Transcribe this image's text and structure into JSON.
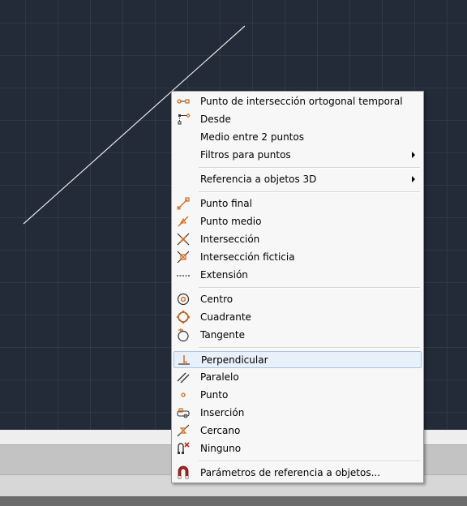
{
  "menu": {
    "items": [
      {
        "label": "Punto de intersección ortogonal temporal",
        "icon": "temporary-track-icon"
      },
      {
        "label": "Desde",
        "icon": "from-icon"
      },
      {
        "label": "Medio entre 2 puntos",
        "icon": ""
      },
      {
        "label": "Filtros para puntos",
        "icon": "",
        "submenu": true
      },
      {
        "label": "Referencia a objetos 3D",
        "icon": "",
        "submenu": true
      },
      {
        "label": "Punto final",
        "icon": "endpoint-icon"
      },
      {
        "label": "Punto medio",
        "icon": "midpoint-icon"
      },
      {
        "label": "Intersección",
        "icon": "intersection-icon"
      },
      {
        "label": "Intersección ficticia",
        "icon": "apparent-intersection-icon"
      },
      {
        "label": "Extensión",
        "icon": "extension-icon"
      },
      {
        "label": "Centro",
        "icon": "center-icon"
      },
      {
        "label": "Cuadrante",
        "icon": "quadrant-icon"
      },
      {
        "label": "Tangente",
        "icon": "tangent-icon"
      },
      {
        "label": "Perpendicular",
        "icon": "perpendicular-icon",
        "highlighted": true
      },
      {
        "label": "Paralelo",
        "icon": "parallel-icon"
      },
      {
        "label": "Punto",
        "icon": "node-icon"
      },
      {
        "label": "Inserción",
        "icon": "insertion-icon"
      },
      {
        "label": "Cercano",
        "icon": "nearest-icon"
      },
      {
        "label": "Ninguno",
        "icon": "none-icon"
      },
      {
        "label": "Parámetros de referencia a objetos...",
        "icon": "osnap-settings-icon"
      }
    ]
  },
  "colors": {
    "canvas": "#232a38",
    "snap_icon": "#d2691e",
    "highlight": "#e8f0fb"
  }
}
